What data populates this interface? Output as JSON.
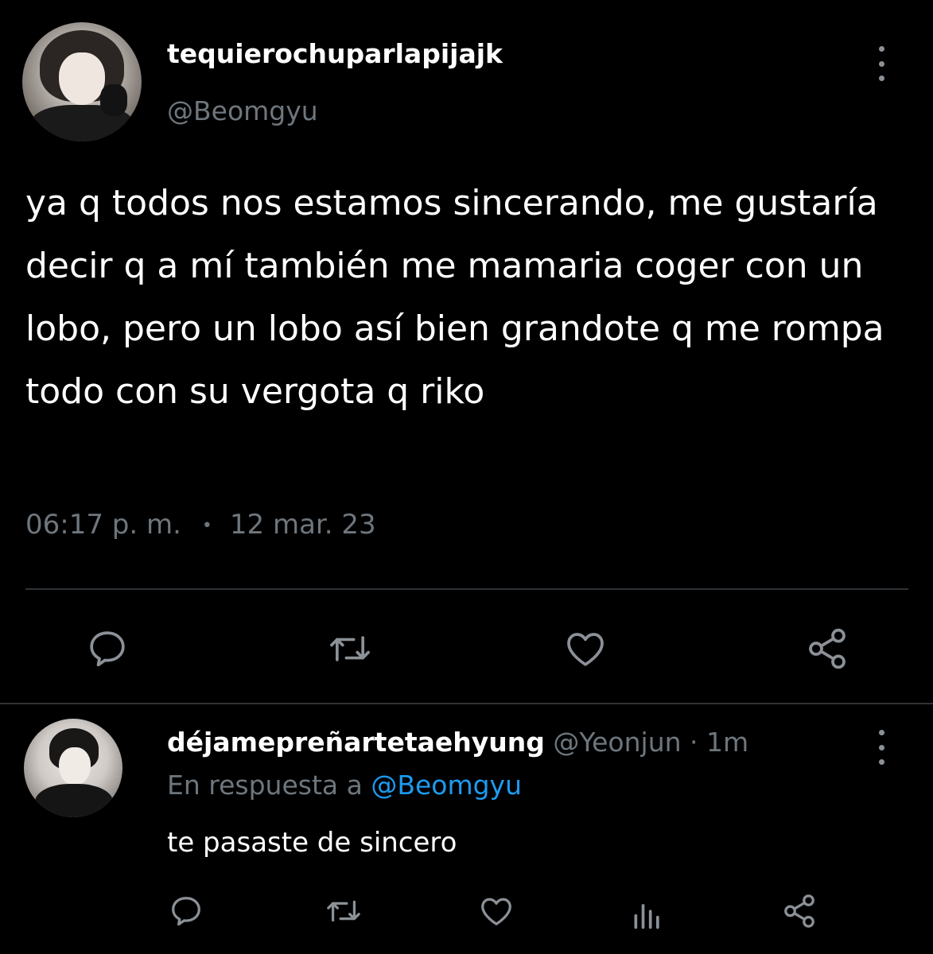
{
  "main_tweet": {
    "display_name": "tequierochuparlapijajk",
    "handle": "@Beomgyu",
    "text": "ya q todos nos estamos sincerando, me gustaría decir q a mí también me mamaria coger con un lobo, pero un lobo así bien grandote q me rompa todo con su vergota q riko",
    "time": "06:17 p. m.",
    "separator": "•",
    "date": "12 mar. 23",
    "actions": [
      "reply-icon",
      "retweet-icon",
      "like-icon",
      "share-icon"
    ]
  },
  "reply": {
    "display_name": "déjamepreñartetaehyung",
    "handle": "@Yeonjun",
    "dot": "·",
    "age": "1m",
    "in_reply_prefix": "En respuesta a",
    "in_reply_mention": "@Beomgyu",
    "text": "te pasaste de sincero",
    "actions": [
      "reply-icon",
      "retweet-icon",
      "like-icon",
      "analytics-icon",
      "share-icon"
    ]
  },
  "colors": {
    "background": "#000000",
    "text_primary": "#ffffff",
    "text_secondary": "#6e767d",
    "mention": "#1d9bf0",
    "divider": "#2f3336",
    "icon": "#8b9197"
  }
}
